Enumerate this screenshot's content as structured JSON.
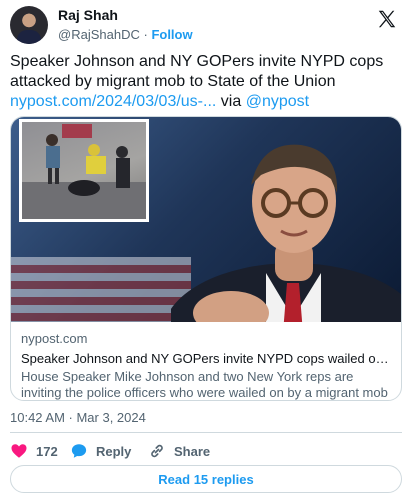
{
  "author": {
    "display_name": "Raj Shah",
    "handle": "@RajShahDC",
    "separator": "·",
    "follow_label": "Follow"
  },
  "platform_logo": "x-logo",
  "tweet": {
    "text": "Speaker Johnson and NY GOPers invite NYPD cops attacked by migrant mob to State of the Union",
    "link_text": "nypost.com/2024/03/03/us-...",
    "via_text": "via",
    "via_handle": "@nypost"
  },
  "link_card": {
    "domain": "nypost.com",
    "title": "Speaker Johnson and NY GOPers invite NYPD cops wailed on by migrant...",
    "description": "House Speaker Mike Johnson and two New York reps are inviting the police officers who were wailed on by a migrant mob near Times Square..."
  },
  "timestamp": "10:42 AM · Mar 3, 2024",
  "actions": {
    "like_count": "172",
    "reply_label": "Reply",
    "share_label": "Share"
  },
  "read_replies_label": "Read 15 replies",
  "colors": {
    "accent": "#1d9bf0",
    "like": "#f91880",
    "text": "#0f1419",
    "muted": "#536471",
    "border": "#cfd9de"
  }
}
